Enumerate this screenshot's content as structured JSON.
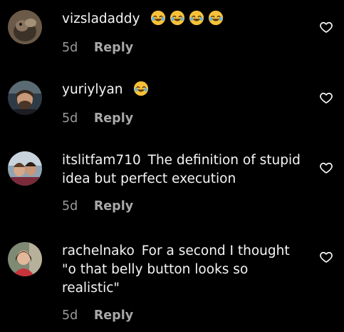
{
  "comments": [
    {
      "username": "vizsladaddy",
      "text": "",
      "emojis": [
        "face-with-tears-of-joy-icon",
        "face-with-tears-of-joy-icon",
        "face-with-tears-of-joy-icon",
        "face-with-tears-of-joy-icon"
      ],
      "time": "5d",
      "reply_label": "Reply"
    },
    {
      "username": "yuriylyan",
      "text": "",
      "emojis": [
        "face-with-tears-of-joy-icon"
      ],
      "time": "5d",
      "reply_label": "Reply"
    },
    {
      "username": "itslitfam710",
      "text": "The definition of stupid idea but perfect execution",
      "emojis": [],
      "time": "5d",
      "reply_label": "Reply"
    },
    {
      "username": "rachelnako",
      "text": "For a second I thought \"o that belly button looks so realistic\"",
      "emojis": [],
      "time": "5d",
      "reply_label": "Reply"
    }
  ],
  "colors": {
    "background": "#000000",
    "text": "#f5f5f5",
    "meta": "#9b9b9b",
    "emoji_face": "#f7c23a"
  },
  "icons": {
    "like": "heart-outline-icon"
  }
}
